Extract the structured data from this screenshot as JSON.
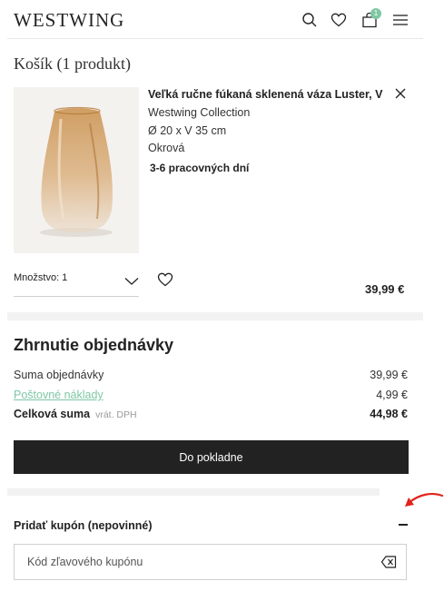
{
  "header": {
    "logo": "WESTWING",
    "cart_count": "1",
    "icons": [
      "search-icon",
      "heart-icon",
      "bag-icon",
      "menu-icon"
    ]
  },
  "cart": {
    "title": "Košík (1 produkt)"
  },
  "product": {
    "name": "Veľká ručne fúkaná sklenená váza Luster, V ...",
    "brand": "Westwing Collection",
    "dimensions": "Ø 20 x V 35 cm",
    "color": "Okrová",
    "delivery": "3-6 pracovných dní",
    "quantity_label": "Množstvo: 1",
    "price": "39,99 €"
  },
  "summary": {
    "title": "Zhrnutie objednávky",
    "subtotal_label": "Suma objednávky",
    "subtotal_value": "39,99 €",
    "shipping_label": "Poštovné náklady",
    "shipping_value": "4,99 €",
    "total_label": "Celková suma",
    "total_vat": "vrát. DPH",
    "total_value": "44,98 €",
    "checkout_label": "Do pokladne"
  },
  "coupon": {
    "label": "Pridať kupón (nepovinné)",
    "placeholder": "Kód zľavového kupónu"
  },
  "colors": {
    "accent": "#7fc7a4",
    "button": "#222222",
    "annotation_arrow": "#e0241b"
  }
}
